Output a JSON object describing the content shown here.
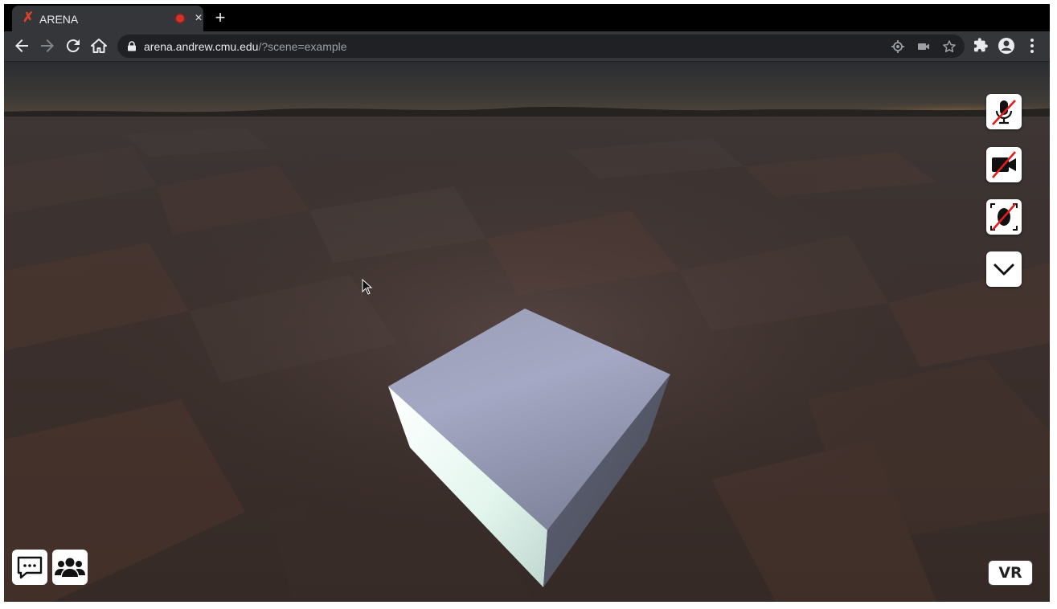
{
  "browser": {
    "tab": {
      "title": "ARENA",
      "favicon": "arena-x-icon",
      "recording_indicator": "recording-dot-icon",
      "close": "×"
    },
    "new_tab": "+",
    "address": {
      "host": "arena.andrew.cmu.edu",
      "path": "/?scene=example"
    },
    "toolbar_icons": [
      "back-icon",
      "forward-icon",
      "reload-icon",
      "home-icon",
      "location-icon",
      "camera-icon",
      "star-icon",
      "extensions-icon",
      "profile-icon",
      "menu-icon"
    ]
  },
  "scene": {
    "controls": {
      "mic": "mic-off-icon",
      "camera": "camera-off-icon",
      "face": "face-tracking-off-icon",
      "more": "chevron-down-icon",
      "chat": "chat-icon",
      "users": "users-icon",
      "vr_label": "VR"
    },
    "colors": {
      "sky_glow": "#c88a3a",
      "ground": "#3a2f2d",
      "box_top": "#8e93ab",
      "box_front": "#e6f5ef"
    }
  }
}
